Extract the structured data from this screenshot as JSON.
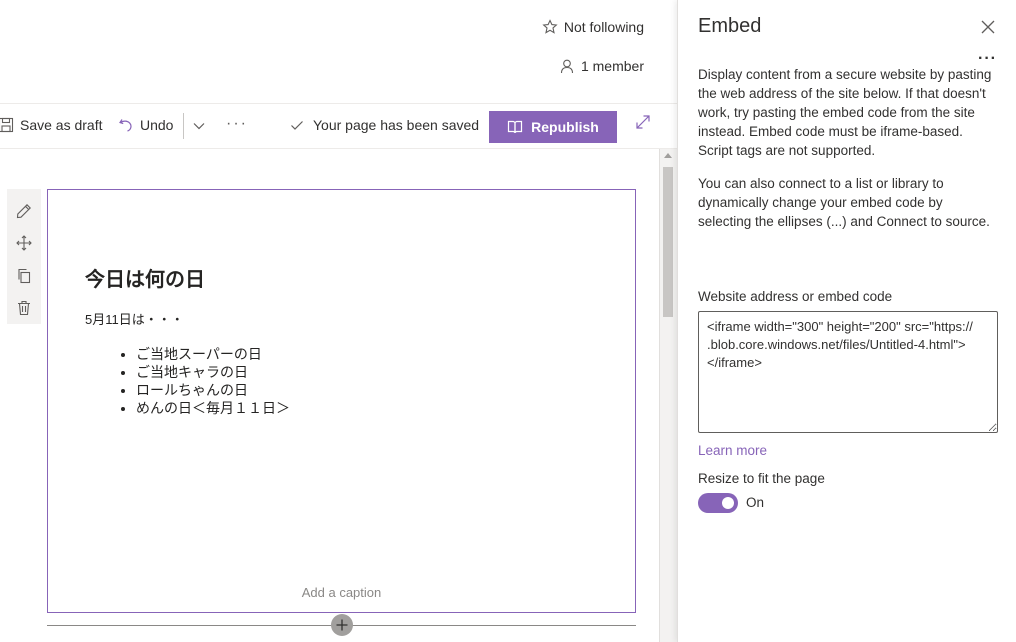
{
  "header": {
    "follow_label": "Not following",
    "members_label": "1 member"
  },
  "toolbar": {
    "save_draft_label": "Save as draft",
    "undo_label": "Undo",
    "more_label": "···",
    "saved_status": "Your page has been saved",
    "republish_label": "Republish"
  },
  "webpart": {
    "title": "今日は何の日",
    "date_line": "5月11日は・・・",
    "items": [
      "ご当地スーパーの日",
      "ご当地キャラの日",
      "ロールちゃんの日",
      "めんの日＜毎月１１日＞"
    ],
    "caption_placeholder": "Add a caption"
  },
  "panel": {
    "title": "Embed",
    "more_label": "···",
    "description_1": "Display content from a secure website by pasting the web address of the site below. If that doesn't work, try pasting the embed code from the site instead. Embed code must be iframe-based. Script tags are not supported.",
    "description_2": "You can also connect to a list or library to dynamically change your embed code by selecting the ellipses (...) and Connect to source.",
    "field_label": "Website address or embed code",
    "embed_code": "<iframe width=\"300\" height=\"200\" src=\"https://          .blob.core.windows.net/files/Untitled-4.html\"></iframe>",
    "learn_more": "Learn more",
    "resize_label": "Resize to fit the page",
    "resize_state": "On"
  },
  "colors": {
    "accent": "#8764b8",
    "text": "#323130",
    "border": "#edebe9"
  }
}
